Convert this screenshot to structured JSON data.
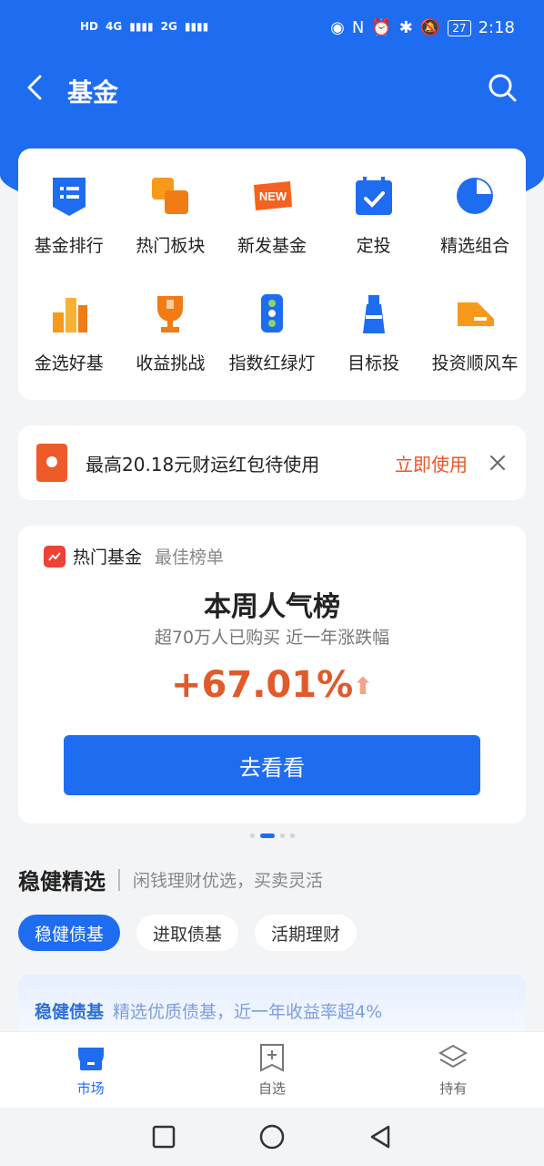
{
  "status": {
    "left_label": "HD",
    "network1": "4G",
    "network2": "2G",
    "battery": "27",
    "time": "2:18"
  },
  "header": {
    "title": "基金"
  },
  "grid": [
    {
      "label": "基金排行",
      "icon": "list-icon"
    },
    {
      "label": "热门板块",
      "icon": "blocks-icon"
    },
    {
      "label": "新发基金",
      "icon": "new-badge-icon"
    },
    {
      "label": "定投",
      "icon": "calendar-check-icon"
    },
    {
      "label": "精选组合",
      "icon": "pie-chart-icon"
    },
    {
      "label": "金选好基",
      "icon": "podium-icon"
    },
    {
      "label": "收益挑战",
      "icon": "trophy-icon"
    },
    {
      "label": "指数红绿灯",
      "icon": "traffic-light-icon"
    },
    {
      "label": "目标投",
      "icon": "lighthouse-icon"
    },
    {
      "label": "投资顺风车",
      "icon": "car-icon"
    }
  ],
  "banner": {
    "text": "最高20.18元财运红包待使用",
    "action": "立即使用"
  },
  "hot": {
    "label": "热门基金",
    "sublabel": "最佳榜单",
    "title": "本周人气榜",
    "desc": "超70万人已购买 近一年涨跌幅",
    "rate": "+67.01%",
    "cta": "去看看"
  },
  "section": {
    "title": "稳健精选",
    "subtitle": "闲钱理财优选，买卖灵活"
  },
  "pills": [
    "稳健债基",
    "进取债基",
    "活期理财"
  ],
  "peek": {
    "title": "稳健债基",
    "desc": "精选优质债基，近一年收益率超4%"
  },
  "tabs": [
    {
      "label": "市场",
      "icon": "store-icon"
    },
    {
      "label": "自选",
      "icon": "add-square-icon"
    },
    {
      "label": "持有",
      "icon": "layers-icon"
    }
  ],
  "colors": {
    "primary": "#1e6cf0",
    "accent": "#e05a2b",
    "orange": "#f79a1c"
  }
}
